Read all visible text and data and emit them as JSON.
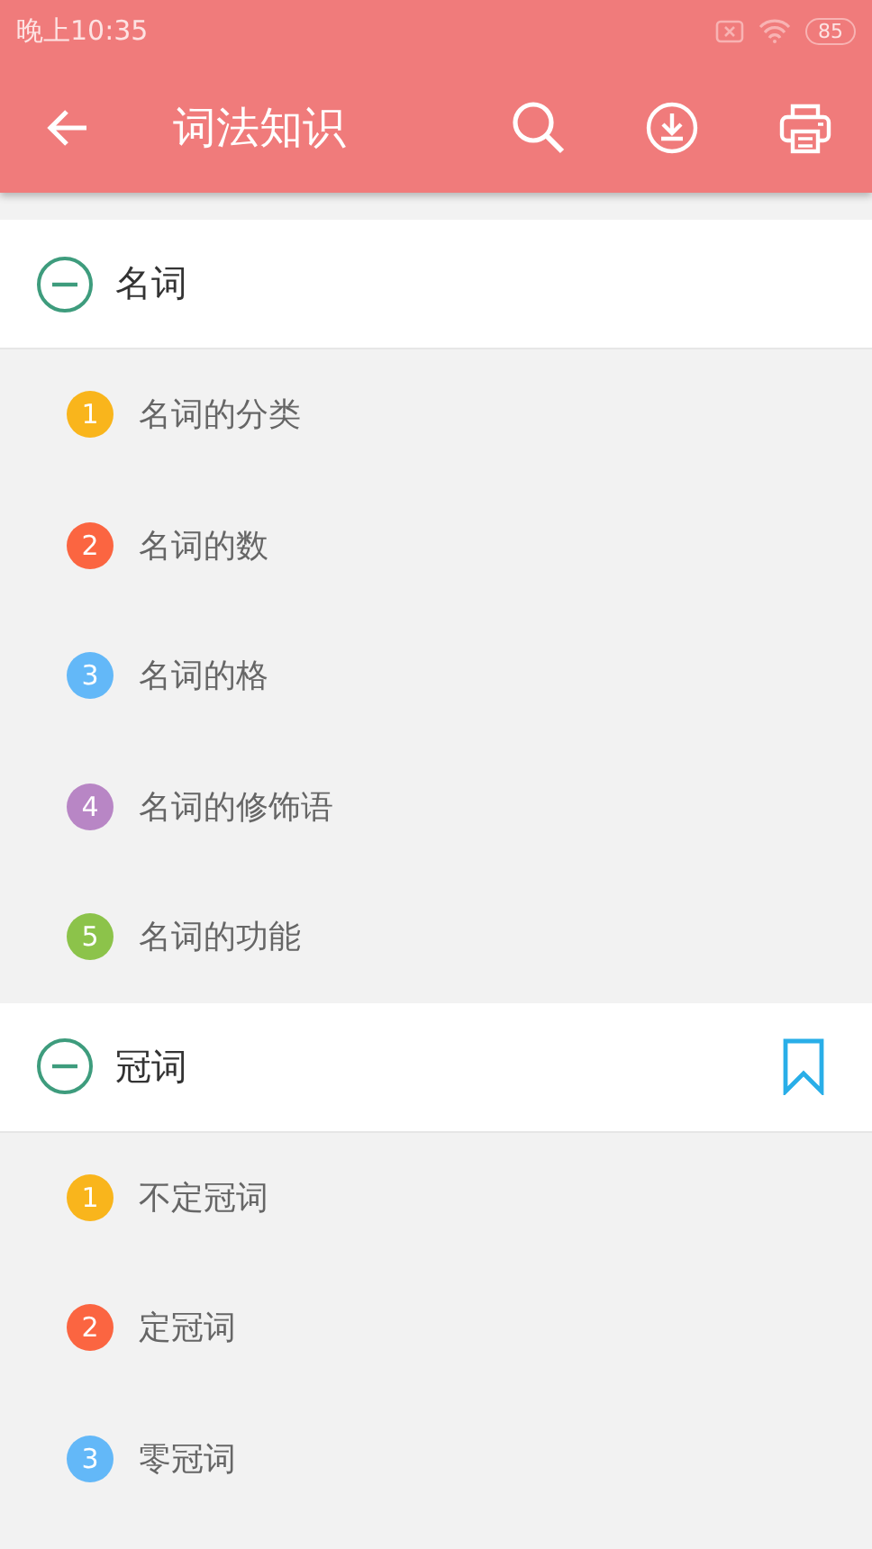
{
  "status_bar": {
    "time": "晚上10:35",
    "battery": "85"
  },
  "app_bar": {
    "title": "词法知识"
  },
  "sections": [
    {
      "title": "名词",
      "expanded": true,
      "bookmarked": false,
      "items": [
        {
          "number": "1",
          "label": "名词的分类",
          "color": "#f9b51c"
        },
        {
          "number": "2",
          "label": "名词的数",
          "color": "#fb6541"
        },
        {
          "number": "3",
          "label": "名词的格",
          "color": "#63b8f8"
        },
        {
          "number": "4",
          "label": "名词的修饰语",
          "color": "#b886c5"
        },
        {
          "number": "5",
          "label": "名词的功能",
          "color": "#8cc34a"
        }
      ]
    },
    {
      "title": "冠词",
      "expanded": true,
      "bookmarked": true,
      "items": [
        {
          "number": "1",
          "label": "不定冠词",
          "color": "#f9b51c"
        },
        {
          "number": "2",
          "label": "定冠词",
          "color": "#fb6541"
        },
        {
          "number": "3",
          "label": "零冠词",
          "color": "#63b8f8"
        }
      ]
    }
  ]
}
